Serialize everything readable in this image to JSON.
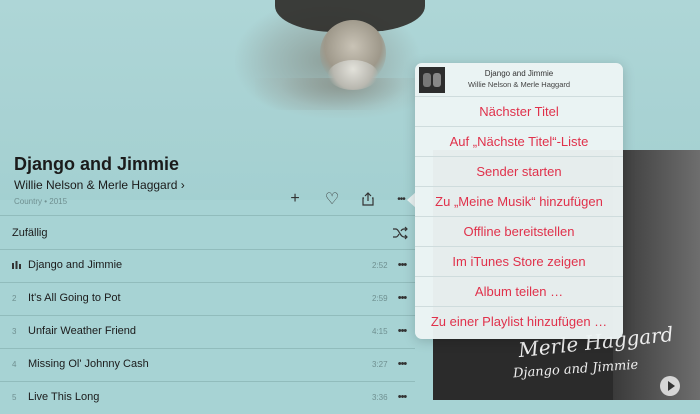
{
  "album": {
    "title": "Django and Jimmie",
    "artist": "Willie Nelson & Merle Haggard",
    "artist_chevron": "›",
    "meta": "Country • 2015"
  },
  "actions": {
    "add": "+",
    "love": "♡",
    "share": "⇪",
    "more": "•••"
  },
  "shuffle": {
    "label": "Zufällig"
  },
  "tracks": [
    {
      "num": "",
      "title": "Django and Jimmie",
      "duration": "2:52",
      "playing": true
    },
    {
      "num": "2",
      "title": "It's All Going to Pot",
      "duration": "2:59"
    },
    {
      "num": "3",
      "title": "Unfair Weather Friend",
      "duration": "4:15"
    },
    {
      "num": "4",
      "title": "Missing Ol' Johnny Cash",
      "duration": "3:27"
    },
    {
      "num": "5",
      "title": "Live This Long",
      "duration": "3:36"
    }
  ],
  "track_more": "•••",
  "menu": {
    "header_song": "Django and Jimmie",
    "header_artist": "Willie Nelson & Merle Haggard",
    "items": [
      "Nächster Titel",
      "Auf „Nächste Titel“-Liste",
      "Sender starten",
      "Zu „Meine Musik“ hinzufügen",
      "Offline bereitstellen",
      "Im iTunes Store zeigen",
      "Album teilen …",
      "Zu einer Playlist hinzufügen …"
    ]
  },
  "album_art": {
    "script_line1": "Merle Haggard",
    "script_line2": "Django and Jimmie"
  },
  "colors": {
    "accent": "#e0314b",
    "background": "#a7d3d4"
  }
}
